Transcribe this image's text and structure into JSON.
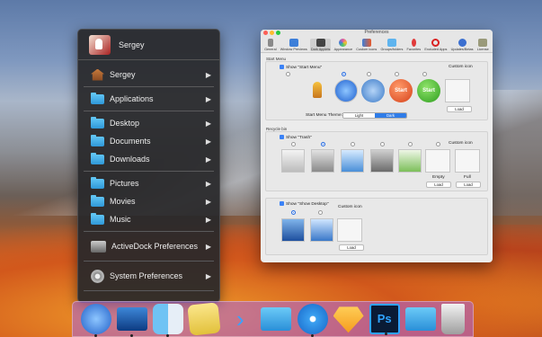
{
  "menu": {
    "user": "Sergey",
    "items": [
      {
        "label": "Sergey",
        "icon": "home-icon"
      },
      {
        "label": "Applications",
        "icon": "folder-icon"
      },
      {
        "label": "Desktop",
        "icon": "folder-icon"
      },
      {
        "label": "Documents",
        "icon": "folder-icon"
      },
      {
        "label": "Downloads",
        "icon": "folder-icon"
      },
      {
        "label": "Pictures",
        "icon": "folder-icon"
      },
      {
        "label": "Movies",
        "icon": "folder-icon"
      },
      {
        "label": "Music",
        "icon": "folder-icon"
      },
      {
        "label": "ActiveDock Preferences",
        "icon": "activedock-icon"
      },
      {
        "label": "System Preferences",
        "icon": "gear-icon"
      }
    ],
    "arrow": "▶"
  },
  "prefs": {
    "title": "Preferences",
    "tabs": [
      {
        "label": "General",
        "color": "#8a8a8a"
      },
      {
        "label": "Window Previews",
        "color": "#3d7fd9"
      },
      {
        "label": "Dark Applets",
        "color": "#444444"
      },
      {
        "label": "Appearance",
        "color": "#e255a4"
      },
      {
        "label": "Custom icons",
        "color": "#3e7fd8"
      },
      {
        "label": "Groups/folders",
        "color": "#5fb4ee"
      },
      {
        "label": "Favorites",
        "color": "#e03a3a"
      },
      {
        "label": "Excluded Apps",
        "color": "#d92222"
      },
      {
        "label": "Updates/Betas",
        "color": "#3b6fd0"
      },
      {
        "label": "License",
        "color": "#9a9a7a"
      }
    ],
    "start_menu": {
      "section_title": "Start Menu",
      "show_label": "Show \"Start Menu\"",
      "custom_icon": "Custom icon",
      "load": "Load",
      "theme_label": "Start Menu Theme:",
      "theme_options": [
        "Light",
        "Dark"
      ],
      "theme_selected": "Dark",
      "start_text": "Start"
    },
    "recycle_bin": {
      "section_title": "Recycle bin",
      "show_label": "Show \"Trash\"",
      "custom_icon": "Custom icon",
      "empty": "Empty",
      "full": "Full",
      "load": "Load"
    },
    "desktop": {
      "show_label": "Show \"Show Desktop\"",
      "custom_icon": "Custom icon",
      "load": "Load"
    }
  },
  "dock_items": [
    "rocket-icon",
    "desktop-icon",
    "finder-icon",
    "notes-icon",
    "arrow-icon",
    "downloads-folder-icon",
    "safari-icon",
    "sketch-icon",
    "photoshop-icon",
    "folder-icon",
    "trash-icon"
  ]
}
